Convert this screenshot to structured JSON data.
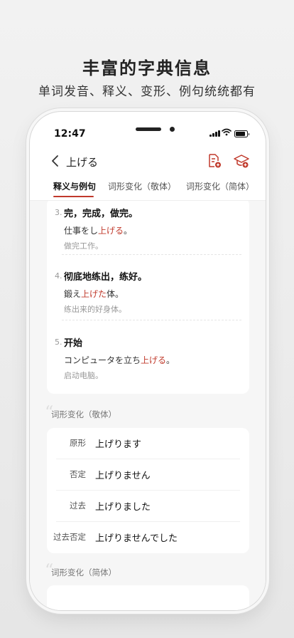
{
  "promo": {
    "title": "丰富的字典信息",
    "subtitle": "单词发音、释义、变形、例句统统都有"
  },
  "status_bar": {
    "time": "12:47"
  },
  "nav": {
    "back_icon": "chevron-left",
    "title": "上げる",
    "icons": [
      "document-add-icon",
      "graduation-cap-add-icon"
    ],
    "accent": "#c0392b"
  },
  "tabs": [
    {
      "label": "释义与例句",
      "active": true
    },
    {
      "label": "词形变化（敬体）",
      "active": false
    },
    {
      "label": "词形变化（简体）",
      "active": false
    }
  ],
  "definitions": [
    {
      "num": "3.",
      "meaning": "完，完成，做完。",
      "ex_pre": "仕事をし",
      "ex_hl": "上げる",
      "ex_post": "。",
      "ex_cn": "做完工作。"
    },
    {
      "num": "4.",
      "meaning": "彻底地练出，练好。",
      "ex_pre": "鍛え",
      "ex_hl": "上げた",
      "ex_post": "体。",
      "ex_cn": "练出来的好身体。"
    },
    {
      "num": "5.",
      "meaning": "开始",
      "ex_pre": "コンピュータを立ち",
      "ex_hl": "上げる",
      "ex_post": "。",
      "ex_cn": "启动电脑。"
    }
  ],
  "conj_polite": {
    "title": "词形变化（敬体）",
    "rows": [
      {
        "label": "原形",
        "value": "上げります"
      },
      {
        "label": "否定",
        "value": "上げりません"
      },
      {
        "label": "过去",
        "value": "上げりました"
      },
      {
        "label": "过去否定",
        "value": "上げりませんでした"
      }
    ]
  },
  "conj_plain": {
    "title": "词形变化（简体）"
  }
}
